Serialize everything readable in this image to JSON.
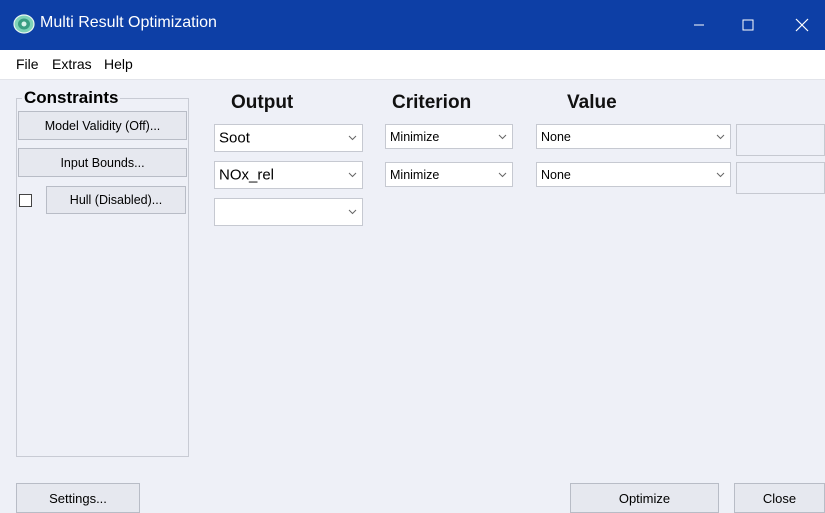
{
  "window": {
    "title": "Multi Result Optimization"
  },
  "menu": [
    "File",
    "Extras",
    "Help"
  ],
  "constraints": {
    "title": "Constraints",
    "model_validity_label": "Model Validity (Off)...",
    "input_bounds_label": "Input Bounds...",
    "hull_label": "Hull (Disabled)...",
    "hull_checked": false
  },
  "columns": {
    "output": "Output",
    "criterion": "Criterion",
    "value": "Value"
  },
  "rows": [
    {
      "output": "Soot",
      "criterion": "Minimize",
      "value": "None",
      "extra": ""
    },
    {
      "output": "NOx_rel",
      "criterion": "Minimize",
      "value": "None",
      "extra": ""
    },
    {
      "output": ""
    }
  ],
  "footer": {
    "settings_label": "Settings...",
    "optimize_label": "Optimize",
    "close_label": "Close"
  },
  "colors": {
    "titlebar": "#0d3fa6",
    "background": "#eef0f7"
  }
}
